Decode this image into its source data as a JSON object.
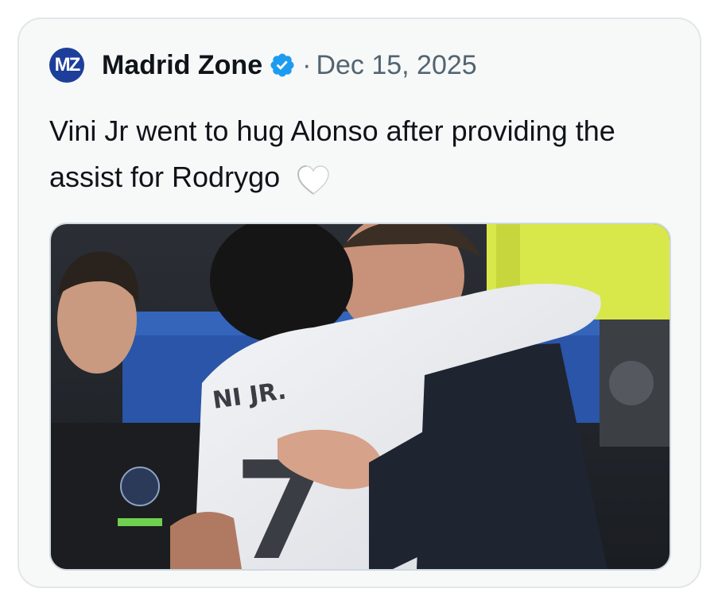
{
  "post": {
    "author": "Madrid Zone",
    "avatar_text": "MZ",
    "separator": "·",
    "date": "Dec 15, 2025",
    "text": "Vini Jr went to hug Alonso after providing the assist for Rodrygo",
    "emoji_icon": "white-heart-icon",
    "verified_icon": "verified-badge-icon",
    "media": {
      "jersey_name": "NI JR.",
      "jersey_number": "7"
    }
  },
  "colors": {
    "card_background": "#f7f9f9",
    "verified_blue": "#1d9bf0",
    "avatar_blue": "#1d3f9a",
    "muted_text": "#536471"
  }
}
